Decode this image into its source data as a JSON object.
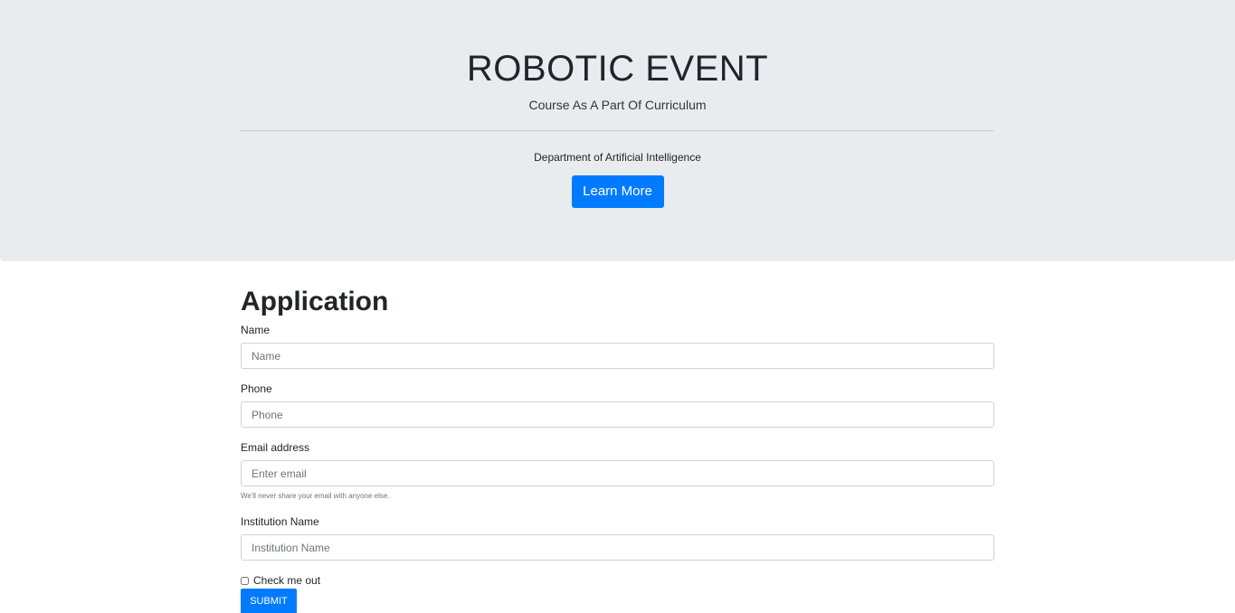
{
  "hero": {
    "title": "ROBOTIC EVENT",
    "subtitle": "Course As A Part Of Curriculum",
    "department": "Department of Artificial Intelligence",
    "button_label": "Learn More"
  },
  "form": {
    "title": "Application",
    "fields": [
      {
        "label": "Name",
        "placeholder": "Name",
        "value": ""
      },
      {
        "label": "Phone",
        "placeholder": "Phone",
        "value": ""
      },
      {
        "label": "Email address",
        "placeholder": "Enter email",
        "value": "",
        "help": "We'll never share your email with anyone else."
      },
      {
        "label": "Institution Name",
        "placeholder": "Institution Name",
        "value": ""
      }
    ],
    "checkbox_label": "Check me out",
    "checkbox_checked": false,
    "submit_label": "SUBMIT"
  },
  "colors": {
    "hero_background": "#e9ecef",
    "primary": "#007bff"
  }
}
